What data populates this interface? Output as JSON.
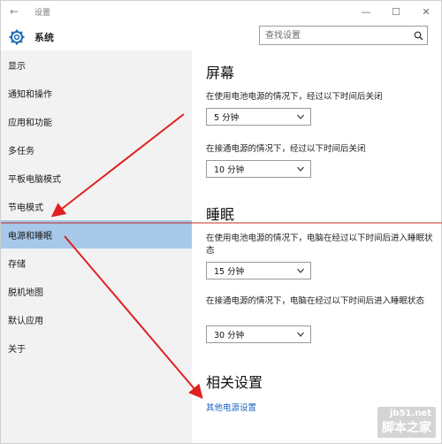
{
  "window": {
    "title": "设置",
    "back_icon": "back-arrow-icon"
  },
  "header": {
    "app_name": "系统",
    "search_placeholder": "查找设置"
  },
  "sidebar": {
    "items": [
      {
        "label": "显示"
      },
      {
        "label": "通知和操作"
      },
      {
        "label": "应用和功能"
      },
      {
        "label": "多任务"
      },
      {
        "label": "平板电脑模式"
      },
      {
        "label": "节电模式"
      },
      {
        "label": "电源和睡眠",
        "selected": true
      },
      {
        "label": "存储"
      },
      {
        "label": "脱机地图"
      },
      {
        "label": "默认应用"
      },
      {
        "label": "关于"
      }
    ]
  },
  "main": {
    "screen": {
      "heading": "屏幕",
      "battery_desc": "在使用电池电源的情况下，经过以下时间后关闭",
      "battery_value": "5 分钟",
      "plugged_desc": "在接通电源的情况下，经过以下时间后关闭",
      "plugged_value": "10 分钟"
    },
    "sleep": {
      "heading": "睡眠",
      "battery_desc": "在使用电池电源的情况下，电脑在经过以下时间后进入睡眠状态",
      "battery_value": "15 分钟",
      "plugged_desc": "在接通电源的情况下，电脑在经过以下时间后进入睡眠状态",
      "plugged_value": "30 分钟"
    },
    "related": {
      "heading": "相关设置",
      "link": "其他电源设置"
    }
  },
  "watermark": {
    "site": "jb51.net",
    "name": "脚本之家"
  },
  "colors": {
    "selected_bg": "#a7c8e8",
    "link": "#1a63c2",
    "annotation": "#e02020"
  }
}
